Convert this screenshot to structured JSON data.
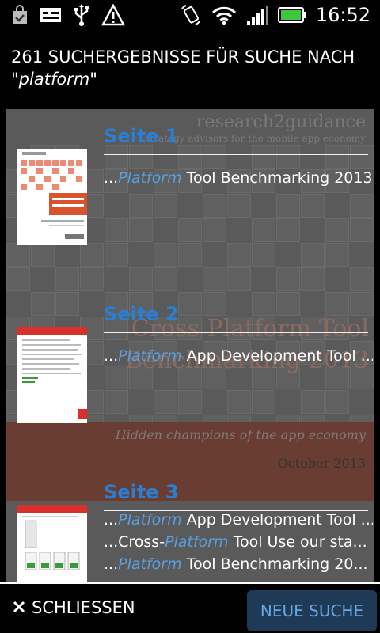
{
  "status_bar": {
    "time": "16:52",
    "icons": [
      "bag-check-icon",
      "mail-icon",
      "usb-icon",
      "warning-icon",
      "rotate-icon",
      "wifi-icon",
      "signal-icon",
      "battery-icon"
    ]
  },
  "header": {
    "prefix": "261 SUCHERGEBNISSE FÜR SUCHE NACH",
    "quote_open": "\"",
    "query": "platform",
    "quote_close": "\""
  },
  "background_doc": {
    "brand": "research2guidance",
    "brand_sub": "strategy advisors for the mobile app economy",
    "title_line1": "Cross Platform Tool",
    "title_line2": "Benchmarking 2013",
    "tagline": "Hidden champions of the app economy",
    "date": "October 2013"
  },
  "results": [
    {
      "heading": "Seite 1",
      "thumbnail": "Cross Platform Tool Benchmarking 2013",
      "snippets": [
        {
          "pre": "...",
          "highlight": "Platform",
          "post": " Tool Benchmarking 2013"
        }
      ]
    },
    {
      "heading": "Seite 2",
      "thumbnail": "Cross Platform Tool Benchmarking 2013",
      "snippets": [
        {
          "pre": "...",
          "highlight": "Platform",
          "post": " App Development Tool ..."
        }
      ]
    },
    {
      "heading": "Seite 3",
      "thumbnail": "Cross Platform Tool Benchmarking 2013",
      "snippets": [
        {
          "pre": "...",
          "highlight": "Platform",
          "post": " App Development Tool ..."
        },
        {
          "pre": "...Cross-",
          "highlight": "Platform",
          "post": " Tool Use our sta..."
        },
        {
          "pre": "...",
          "highlight": "Platform",
          "post": " Tool Benchmarking 20..."
        }
      ]
    }
  ],
  "bottom_bar": {
    "close_label": "SCHLIESSEN",
    "new_search_label": "NEUE SUCHE"
  },
  "colors": {
    "accent_blue": "#2a7fd2",
    "highlight_blue": "#5a9fe0",
    "button_bg": "#1f3a57",
    "battery_green": "#3cc83c"
  }
}
